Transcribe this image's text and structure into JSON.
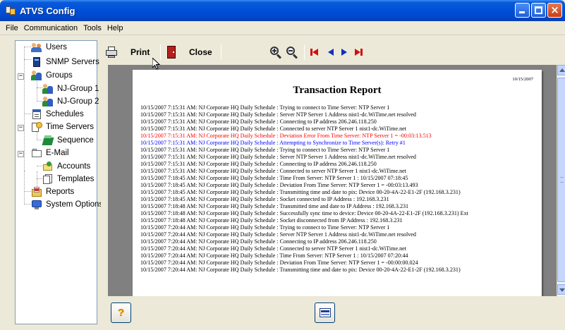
{
  "window": {
    "title": "ATVS Config",
    "colors": {
      "titlebar": "#0050d8",
      "background": "#ece9d8"
    }
  },
  "menu": {
    "items": [
      "File",
      "Communication",
      "Tools",
      "Help"
    ]
  },
  "tree": {
    "nodes": [
      {
        "label": "Users",
        "icon": "users-icon"
      },
      {
        "label": "SNMP Servers",
        "icon": "server-icon"
      },
      {
        "label": "Groups",
        "icon": "group-icon",
        "expander": "−"
      },
      {
        "label": "NJ-Group 1",
        "icon": "group-icon"
      },
      {
        "label": "NJ-Group 2",
        "icon": "group-icon"
      },
      {
        "label": "Schedules",
        "icon": "calendar-icon"
      },
      {
        "label": "Time Servers",
        "icon": "time-server-icon",
        "expander": "−"
      },
      {
        "label": "Sequence",
        "icon": "sequence-icon"
      },
      {
        "label": "E-Mail",
        "icon": "mail-icon",
        "expander": "−"
      },
      {
        "label": "Accounts",
        "icon": "accounts-icon"
      },
      {
        "label": "Templates",
        "icon": "templates-icon"
      },
      {
        "label": "Reports",
        "icon": "reports-icon"
      },
      {
        "label": "System Options",
        "icon": "system-options-icon"
      }
    ]
  },
  "toolbar": {
    "print_label": "Print",
    "close_label": "Close",
    "icons": [
      "printer-icon",
      "door-icon",
      "zoom-in-icon",
      "zoom-out-icon",
      "first-page-icon",
      "previous-page-icon",
      "next-page-icon",
      "last-page-icon"
    ],
    "nav_color": "#d01010",
    "nav_blue": "#1030c0"
  },
  "report": {
    "date": "10/15/2007",
    "title": "Transaction Report",
    "lines": [
      {
        "text": "10/15/2007 7:15:31 AM: NJ Corporate HQ Daily Schedule : Trying to connect to Time Server: NTP Server 1",
        "color": "black"
      },
      {
        "text": "10/15/2007 7:15:31 AM: NJ Corporate HQ Daily Schedule : Server NTP Server 1 Address nist1-dc.WiTime.net resolved",
        "color": "black"
      },
      {
        "text": "10/15/2007 7:15:31 AM: NJ Corporate HQ Daily Schedule : Connecting to IP address 206.246.118.250",
        "color": "black"
      },
      {
        "text": "10/15/2007 7:15:31 AM: NJ Corporate HQ Daily Schedule : Connected to server NTP Server 1 nist1-dc.WiTime.net",
        "color": "black"
      },
      {
        "text": "10/15/2007 7:15:31 AM: NJ Corporate HQ Daily Schedule : Deviation Error From Time Server: NTP Server 1 = -00:03:13.513",
        "color": "red"
      },
      {
        "text": "10/15/2007 7:15:31 AM: NJ Corporate HQ Daily Schedule : Attempting to Synchronize to Time Server(s): Retry #1",
        "color": "blue"
      },
      {
        "text": "10/15/2007 7:15:31 AM: NJ Corporate HQ Daily Schedule : Trying to connect to Time Server: NTP Server 1",
        "color": "black"
      },
      {
        "text": "10/15/2007 7:15:31 AM: NJ Corporate HQ Daily Schedule : Server NTP Server 1 Address nist1-dc.WiTime.net resolved",
        "color": "black"
      },
      {
        "text": "10/15/2007 7:15:31 AM: NJ Corporate HQ Daily Schedule : Connecting to IP address 206.246.118.250",
        "color": "black"
      },
      {
        "text": "10/15/2007 7:15:31 AM: NJ Corporate HQ Daily Schedule : Connected to server NTP Server 1 nist1-dc.WiTime.net",
        "color": "black"
      },
      {
        "text": "10/15/2007 7:18:45 AM: NJ Corporate HQ Daily Schedule : Time From Server: NTP Server 1 : 10/15/2007 07:18:45",
        "color": "black"
      },
      {
        "text": "10/15/2007 7:18:45 AM: NJ Corporate HQ Daily Schedule : Deviation From Time Server: NTP Server 1 = -00:03:13.493",
        "color": "black"
      },
      {
        "text": "10/15/2007 7:18:45 AM: NJ Corporate HQ Daily Schedule : Transmitting time and date to pix: Device 00-20-4A-22-E1-2F (192.168.3.231)",
        "color": "black"
      },
      {
        "text": "10/15/2007 7:18:45 AM: NJ Corporate HQ Daily Schedule : Socket connected to IP Address : 192.168.3.231",
        "color": "black"
      },
      {
        "text": "10/15/2007 7:18:48 AM: NJ Corporate HQ Daily Schedule : Transmitted time and date to IP Address : 192.168.3.231",
        "color": "black"
      },
      {
        "text": "10/15/2007 7:18:48 AM: NJ Corporate HQ Daily Schedule : Successfully sync time to device: Device 00-20-4A-22-E1-2F (192.168.3.231) Ext",
        "color": "black"
      },
      {
        "text": "10/15/2007 7:18:48 AM: NJ Corporate HQ Daily Schedule : Socket disconnected from IP Address : 192.168.3.231",
        "color": "black"
      },
      {
        "text": "10/15/2007 7:20:44 AM: NJ Corporate HQ Daily Schedule : Trying to connect to Time Server: NTP Server 1",
        "color": "black"
      },
      {
        "text": "10/15/2007 7:20:44 AM: NJ Corporate HQ Daily Schedule : Server NTP Server 1 Address nist1-dc.WiTime.net resolved",
        "color": "black"
      },
      {
        "text": "10/15/2007 7:20:44 AM: NJ Corporate HQ Daily Schedule : Connecting to IP address 206.246.118.250",
        "color": "black"
      },
      {
        "text": "10/15/2007 7:20:44 AM: NJ Corporate HQ Daily Schedule : Connected to server NTP Server 1 nist1-dc.WiTime.net",
        "color": "black"
      },
      {
        "text": "10/15/2007 7:20:44 AM: NJ Corporate HQ Daily Schedule : Time From Server: NTP Server 1 : 10/15/2007 07:20:44",
        "color": "black"
      },
      {
        "text": "10/15/2007 7:20:44 AM: NJ Corporate HQ Daily Schedule : Deviation From Time Server: NTP Server 1 = -00:00:00.024",
        "color": "black"
      },
      {
        "text": "10/15/2007 7:20:44 AM: NJ Corporate HQ Daily Schedule : Transmitting time and date to pix: Device 00-20-4A-22-E1-2F (192.168.3.231)",
        "color": "black"
      }
    ]
  },
  "bottom": {
    "help_label": "?",
    "help_icon": "help-icon",
    "print_icon": "print-preview-icon"
  }
}
